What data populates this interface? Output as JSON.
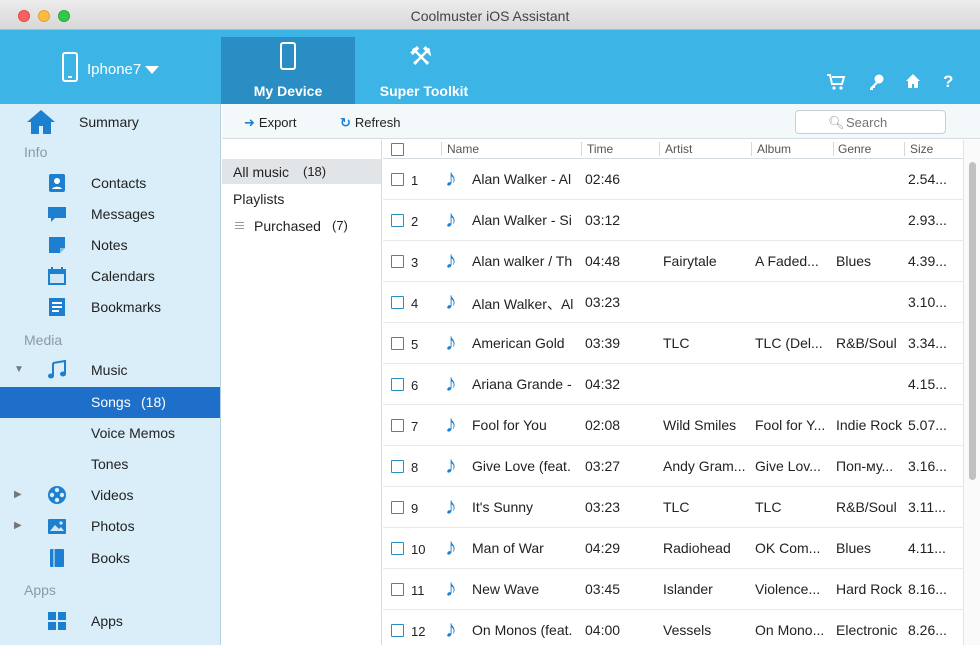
{
  "window": {
    "title": "Coolmuster iOS Assistant"
  },
  "header": {
    "device_name": "Iphone7",
    "tabs": [
      {
        "label": "My Device",
        "icon": "phone-icon",
        "active": true
      },
      {
        "label": "Super Toolkit",
        "icon": "tools-icon",
        "active": false
      }
    ],
    "right_icons": [
      "cart-icon",
      "key-icon",
      "home-icon",
      "help-icon"
    ]
  },
  "sidebar": {
    "summary": "Summary",
    "sections": {
      "info": "Info",
      "media": "Media",
      "apps": "Apps"
    },
    "info_items": [
      "Contacts",
      "Messages",
      "Notes",
      "Calendars",
      "Bookmarks"
    ],
    "media": {
      "music": "Music",
      "songs": "Songs",
      "songs_count": "(18)",
      "voice_memos": "Voice Memos",
      "tones": "Tones",
      "videos": "Videos",
      "photos": "Photos",
      "books": "Books"
    },
    "apps_item": "Apps"
  },
  "toolbar": {
    "export": "Export",
    "refresh": "Refresh",
    "search_placeholder": "Search"
  },
  "categories": {
    "all_music": "All music",
    "all_music_count": "(18)",
    "playlists": "Playlists",
    "purchased": "Purchased",
    "purchased_count": "(7)"
  },
  "table": {
    "columns": [
      "Name",
      "Time",
      "Artist",
      "Album",
      "Genre",
      "Size"
    ],
    "rows": [
      {
        "idx": "1",
        "name": "Alan Walker - Al",
        "time": "02:46",
        "artist": "",
        "album": "",
        "genre": "",
        "size": "2.54..."
      },
      {
        "idx": "2",
        "name": "Alan Walker - Si",
        "time": "03:12",
        "artist": "",
        "album": "",
        "genre": "",
        "size": "2.93..."
      },
      {
        "idx": "3",
        "name": "Alan walker / Th",
        "time": "04:48",
        "artist": "Fairytale",
        "album": "A Faded...",
        "genre": "Blues",
        "size": "4.39..."
      },
      {
        "idx": "4",
        "name": "Alan Walker、Al",
        "time": "03:23",
        "artist": "",
        "album": "",
        "genre": "",
        "size": "3.10..."
      },
      {
        "idx": "5",
        "name": "American Gold",
        "time": "03:39",
        "artist": "TLC",
        "album": "TLC (Del...",
        "genre": "R&B/Soul",
        "size": "3.34..."
      },
      {
        "idx": "6",
        "name": "Ariana Grande -",
        "time": "04:32",
        "artist": "",
        "album": "",
        "genre": "",
        "size": "4.15..."
      },
      {
        "idx": "7",
        "name": "Fool for You",
        "time": "02:08",
        "artist": "Wild Smiles",
        "album": "Fool for Y...",
        "genre": "Indie Rock",
        "size": "5.07..."
      },
      {
        "idx": "8",
        "name": "Give Love (feat.",
        "time": "03:27",
        "artist": "Andy Gram...",
        "album": "Give Lov...",
        "genre": "Поп-му...",
        "size": "3.16..."
      },
      {
        "idx": "9",
        "name": "It's Sunny",
        "time": "03:23",
        "artist": "TLC",
        "album": "TLC",
        "genre": "R&B/Soul",
        "size": "3.11..."
      },
      {
        "idx": "10",
        "name": "Man of War",
        "time": "04:29",
        "artist": "Radiohead",
        "album": "OK Com...",
        "genre": "Blues",
        "size": "4.11..."
      },
      {
        "idx": "11",
        "name": "New Wave",
        "time": "03:45",
        "artist": "Islander",
        "album": "Violence...",
        "genre": "Hard Rock",
        "size": "8.16..."
      },
      {
        "idx": "12",
        "name": "On Monos (feat.",
        "time": "04:00",
        "artist": "Vessels",
        "album": "On Mono...",
        "genre": "Electronic",
        "size": "8.26..."
      }
    ]
  },
  "colors": {
    "header_bg": "#3cb4e6",
    "active_tab": "#2a8ec4",
    "sidebar_bg": "#d9eef8",
    "selection": "#1d6fc9",
    "icon_blue": "#1c7fcf"
  }
}
